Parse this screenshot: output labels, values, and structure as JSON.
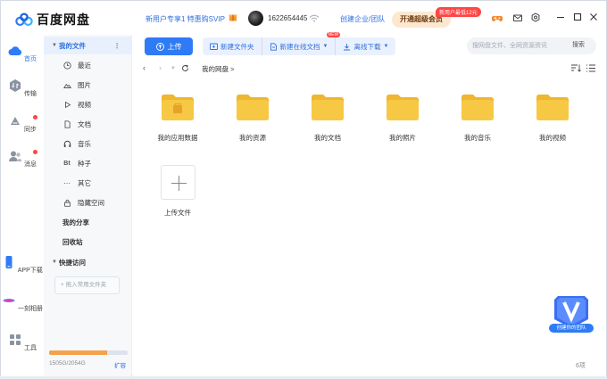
{
  "app": {
    "logo_text": "百度网盘"
  },
  "titlebar": {
    "promo_text": "新用户专享1 特惠购SVIP",
    "user_id": "1622654445",
    "team_link": "创建企业/团队",
    "vip_button": "开通超级会员",
    "vip_badge": "新用户最低12元",
    "icons": [
      "gift-icon",
      "wifi-icon",
      "game-icon",
      "mail-icon",
      "settings-icon",
      "minimize-icon",
      "maximize-icon",
      "close-icon"
    ]
  },
  "rail": {
    "items": [
      {
        "label": "首页",
        "icon": "home-cloud-icon",
        "active": true
      },
      {
        "label": "传输",
        "icon": "transfer-icon"
      },
      {
        "label": "同步",
        "icon": "sync-icon",
        "dot": true
      },
      {
        "label": "消息",
        "icon": "message-icon",
        "dot": true
      },
      {
        "label": "APP下载",
        "icon": "phone-icon"
      },
      {
        "label": "一刻相册",
        "icon": "album-icon"
      },
      {
        "label": "工具",
        "icon": "tools-icon"
      }
    ]
  },
  "sidebar": {
    "my_files": "我的文件",
    "items": [
      {
        "label": "最近",
        "icon": "clock-icon"
      },
      {
        "label": "图片",
        "icon": "image-icon"
      },
      {
        "label": "视频",
        "icon": "video-icon"
      },
      {
        "label": "文档",
        "icon": "document-icon"
      },
      {
        "label": "音乐",
        "icon": "headphone-icon"
      },
      {
        "label": "种子",
        "icon": "bt-icon",
        "glyph": "Bt"
      },
      {
        "label": "其它",
        "icon": "more-icon"
      },
      {
        "label": "隐藏空间",
        "icon": "lock-icon"
      }
    ],
    "my_share": "我的分享",
    "recycle": "回收站",
    "quick_access": "快捷访问",
    "quick_add": "+ 拖入常用文件夹",
    "quota_text": "1505G/2054G",
    "quota_fraction": 0.733,
    "expand_label": "扩容"
  },
  "toolbar": {
    "upload": "上传",
    "new_folder": "新建文件夹",
    "new_online_doc": "新建在线文档",
    "new_badge": "NEW",
    "offline_download": "离线下载",
    "search_placeholder": "搜网盘文件、全网资源资讯",
    "search_button": "搜索"
  },
  "breadcrumb": {
    "current": "我的网盘 >"
  },
  "folders": [
    {
      "label": "我的应用数据",
      "icon": "app-folder-icon"
    },
    {
      "label": "我的资源",
      "icon": "folder-icon"
    },
    {
      "label": "我的文档",
      "icon": "folder-icon"
    },
    {
      "label": "我的照片",
      "icon": "folder-icon"
    },
    {
      "label": "我的音乐",
      "icon": "folder-icon"
    },
    {
      "label": "我的视频",
      "icon": "folder-icon"
    }
  ],
  "upload_tile_label": "上传文件",
  "item_count": "6项",
  "team_float_label": "创建你的团队",
  "colors": {
    "accent": "#2f7bf6",
    "folder": "#f7c844",
    "folder_dark": "#efb62f",
    "vip_bg": "#fde7cf",
    "badge": "#ff4545"
  }
}
